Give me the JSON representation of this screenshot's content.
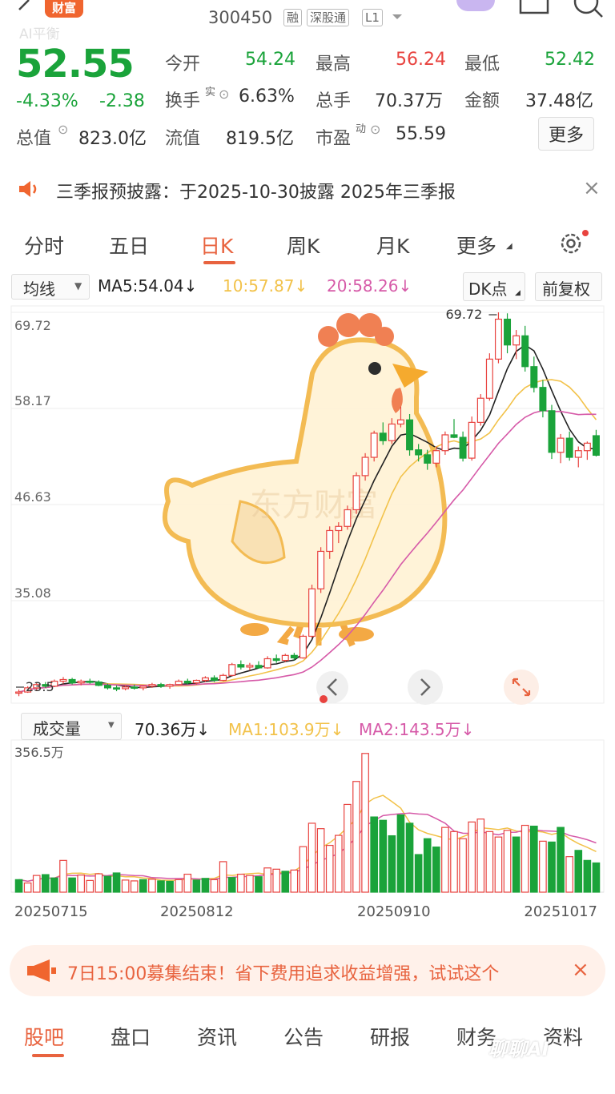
{
  "header": {
    "app_badge": "财富",
    "stock_code": "300450",
    "badges": [
      "融",
      "深股通",
      "L1"
    ],
    "ai_label": "AI平衡"
  },
  "quote": {
    "price": "52.55",
    "change_pct": "-4.33%",
    "change": "-2.38",
    "fields": [
      {
        "label": "今开",
        "value": "54.24",
        "color": "green"
      },
      {
        "label": "最高",
        "value": "56.24",
        "color": "red"
      },
      {
        "label": "最低",
        "value": "52.42",
        "color": "green"
      },
      {
        "label": "换手",
        "sup": "实",
        "value": "6.63%",
        "color": "dark"
      },
      {
        "label": "总手",
        "value": "70.37万",
        "color": "dark"
      },
      {
        "label": "金额",
        "value": "37.48亿",
        "color": "dark"
      },
      {
        "label": "总值",
        "value": "823.0亿",
        "color": "dark"
      },
      {
        "label": "流值",
        "value": "819.5亿",
        "color": "dark"
      },
      {
        "label": "市盈",
        "sup": "动",
        "value": "55.59",
        "color": "dark"
      }
    ],
    "more_button": "更多"
  },
  "notice": {
    "text": "三季报预披露：于2025-10-30披露 2025年三季报"
  },
  "tabs": [
    "分时",
    "五日",
    "日K",
    "周K",
    "月K",
    "更多"
  ],
  "active_tab": "日K",
  "kline_controls": {
    "indicator_select": "均线",
    "ma5": "MA5:54.04↓",
    "ma10": "10:57.87↓",
    "ma20": "20:58.26↓",
    "dk_button": "DK点",
    "adjust_button": "前复权"
  },
  "colors": {
    "up": "#e8433f",
    "down": "#1aa33a",
    "ma5": "#222222",
    "ma10": "#f2c24a",
    "ma20": "#d65aa8",
    "accent": "#e8633f"
  },
  "chart_data": {
    "type": "candlestick",
    "y_ticks": [
      "69.72",
      "58.17",
      "46.63",
      "35.08",
      "23.53"
    ],
    "ylim": [
      23.53,
      69.72
    ],
    "max_label": "69.72",
    "min_label": "23.5",
    "volume_max_label": "356.5万",
    "x_ticks": [
      "20250715",
      "20250812",
      "20250910",
      "20251017"
    ],
    "watermark": "东方财富",
    "volume_controls": {
      "select": "成交量",
      "vol": "70.36万↓",
      "ma1": "MA1:103.9万↓",
      "ma2": "MA2:143.5万↓"
    },
    "candles": [
      [
        24.0,
        24.4,
        23.6,
        24.1
      ],
      [
        24.1,
        24.8,
        24.0,
        24.6
      ],
      [
        24.6,
        25.2,
        24.3,
        25.0
      ],
      [
        25.0,
        25.3,
        24.6,
        24.8
      ],
      [
        24.8,
        25.6,
        24.7,
        25.4
      ],
      [
        25.4,
        25.9,
        25.1,
        25.6
      ],
      [
        25.6,
        25.8,
        25.0,
        25.2
      ],
      [
        25.2,
        25.6,
        24.9,
        25.4
      ],
      [
        25.4,
        25.7,
        25.1,
        25.3
      ],
      [
        25.3,
        25.5,
        24.8,
        24.9
      ],
      [
        24.9,
        25.1,
        24.4,
        24.6
      ],
      [
        24.6,
        24.9,
        24.2,
        24.5
      ],
      [
        24.5,
        24.9,
        24.3,
        24.7
      ],
      [
        24.7,
        25.0,
        24.4,
        24.6
      ],
      [
        24.6,
        24.9,
        24.3,
        24.8
      ],
      [
        24.8,
        25.2,
        24.6,
        25.0
      ],
      [
        25.0,
        25.2,
        24.6,
        24.8
      ],
      [
        24.8,
        25.1,
        24.5,
        25.0
      ],
      [
        25.0,
        25.6,
        24.9,
        25.4
      ],
      [
        25.4,
        25.7,
        25.0,
        25.2
      ],
      [
        25.2,
        25.6,
        25.0,
        25.5
      ],
      [
        25.5,
        26.0,
        25.3,
        25.8
      ],
      [
        25.8,
        26.1,
        25.3,
        25.5
      ],
      [
        25.5,
        26.3,
        25.4,
        26.1
      ],
      [
        26.1,
        27.6,
        26.0,
        27.4
      ],
      [
        27.4,
        27.9,
        26.8,
        27.1
      ],
      [
        27.1,
        27.6,
        26.7,
        27.3
      ],
      [
        27.3,
        27.8,
        26.9,
        27.0
      ],
      [
        27.0,
        28.4,
        26.9,
        28.1
      ],
      [
        28.1,
        28.6,
        27.6,
        27.9
      ],
      [
        27.9,
        28.7,
        27.7,
        28.5
      ],
      [
        28.5,
        28.8,
        27.9,
        28.2
      ],
      [
        28.2,
        31.0,
        28.1,
        30.8
      ],
      [
        30.8,
        37.0,
        30.6,
        36.5
      ],
      [
        36.5,
        41.5,
        36.0,
        41.0
      ],
      [
        41.0,
        44.0,
        40.1,
        43.5
      ],
      [
        43.5,
        44.5,
        42.0,
        44.0
      ],
      [
        44.0,
        46.5,
        43.6,
        46.0
      ],
      [
        46.0,
        50.5,
        45.5,
        50.1
      ],
      [
        50.1,
        52.8,
        49.5,
        52.3
      ],
      [
        52.3,
        55.5,
        51.8,
        55.2
      ],
      [
        55.2,
        56.5,
        53.8,
        54.3
      ],
      [
        54.3,
        57.0,
        53.9,
        56.3
      ],
      [
        56.3,
        58.4,
        55.9,
        56.8
      ],
      [
        56.8,
        57.5,
        52.5,
        53.2
      ],
      [
        53.2,
        53.9,
        51.8,
        52.6
      ],
      [
        52.6,
        53.2,
        50.8,
        51.6
      ],
      [
        51.6,
        53.6,
        51.1,
        53.1
      ],
      [
        53.1,
        55.4,
        52.6,
        55.0
      ],
      [
        55.0,
        56.9,
        54.6,
        54.7
      ],
      [
        54.7,
        55.4,
        51.8,
        52.2
      ],
      [
        52.2,
        57.2,
        51.9,
        56.5
      ],
      [
        56.5,
        59.9,
        56.1,
        59.4
      ],
      [
        59.4,
        64.8,
        59.1,
        64.1
      ],
      [
        64.1,
        69.72,
        63.6,
        68.9
      ],
      [
        68.9,
        69.6,
        64.8,
        65.8
      ],
      [
        65.8,
        67.6,
        64.1,
        66.9
      ],
      [
        66.9,
        68.1,
        62.6,
        63.2
      ],
      [
        63.2,
        64.4,
        60.1,
        60.7
      ],
      [
        60.7,
        61.6,
        57.1,
        57.9
      ],
      [
        57.9,
        58.6,
        52.1,
        52.9
      ],
      [
        52.9,
        55.1,
        51.6,
        54.6
      ],
      [
        54.6,
        55.4,
        51.9,
        52.3
      ],
      [
        52.3,
        53.6,
        51.1,
        53.1
      ],
      [
        53.1,
        54.2,
        52.0,
        54.0
      ],
      [
        54.9,
        55.6,
        52.4,
        52.55
      ]
    ],
    "volumes": [
      [
        30,
        "down"
      ],
      [
        22,
        "up"
      ],
      [
        40,
        "up"
      ],
      [
        42,
        "down"
      ],
      [
        34,
        "down"
      ],
      [
        76,
        "up"
      ],
      [
        34,
        "down"
      ],
      [
        41,
        "up"
      ],
      [
        28,
        "up"
      ],
      [
        44,
        "up"
      ],
      [
        38,
        "down"
      ],
      [
        46,
        "down"
      ],
      [
        29,
        "up"
      ],
      [
        27,
        "up"
      ],
      [
        30,
        "down"
      ],
      [
        31,
        "up"
      ],
      [
        27,
        "down"
      ],
      [
        26,
        "down"
      ],
      [
        30,
        "up"
      ],
      [
        43,
        "up"
      ],
      [
        29,
        "down"
      ],
      [
        33,
        "down"
      ],
      [
        30,
        "up"
      ],
      [
        73,
        "up"
      ],
      [
        35,
        "down"
      ],
      [
        43,
        "up"
      ],
      [
        40,
        "up"
      ],
      [
        37,
        "down"
      ],
      [
        58,
        "up"
      ],
      [
        55,
        "up"
      ],
      [
        50,
        "down"
      ],
      [
        53,
        "up"
      ],
      [
        109,
        "up"
      ],
      [
        165,
        "up"
      ],
      [
        152,
        "up"
      ],
      [
        112,
        "up"
      ],
      [
        136,
        "up"
      ],
      [
        210,
        "up"
      ],
      [
        265,
        "up"
      ],
      [
        332,
        "up"
      ],
      [
        180,
        "down"
      ],
      [
        172,
        "down"
      ],
      [
        135,
        "down"
      ],
      [
        185,
        "down"
      ],
      [
        165,
        "down"
      ],
      [
        90,
        "down"
      ],
      [
        128,
        "down"
      ],
      [
        108,
        "down"
      ],
      [
        155,
        "up"
      ],
      [
        145,
        "up"
      ],
      [
        128,
        "up"
      ],
      [
        168,
        "up"
      ],
      [
        175,
        "up"
      ],
      [
        145,
        "up"
      ],
      [
        132,
        "up"
      ],
      [
        148,
        "up"
      ],
      [
        132,
        "down"
      ],
      [
        160,
        "up"
      ],
      [
        158,
        "down"
      ],
      [
        122,
        "up"
      ],
      [
        120,
        "down"
      ],
      [
        155,
        "down"
      ],
      [
        85,
        "up"
      ],
      [
        100,
        "down"
      ],
      [
        76,
        "down"
      ],
      [
        70,
        "down"
      ]
    ]
  },
  "promo": {
    "text": "7日15:00募集结束！省下费用追求收益增强，试试这个"
  },
  "bottom_tabs": [
    "股吧",
    "盘口",
    "资讯",
    "公告",
    "研报",
    "财务",
    "资料"
  ],
  "bottom_active": "股吧",
  "footer_watermark": "聊聊AI"
}
